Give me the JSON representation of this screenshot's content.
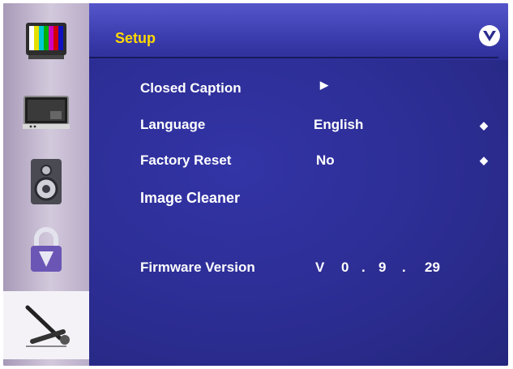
{
  "sidebar": {
    "items": [
      {
        "icon": "picture-tv-icon",
        "selected": false
      },
      {
        "icon": "monitor-icon",
        "selected": false
      },
      {
        "icon": "speaker-icon",
        "selected": false
      },
      {
        "icon": "lock-icon",
        "selected": false
      },
      {
        "icon": "wrench-screwdriver-icon",
        "selected": true
      }
    ]
  },
  "header": {
    "title": "Setup",
    "logo": "v-logo-icon",
    "title_color": "#ffd800"
  },
  "menu": {
    "closed_caption": {
      "label": "Closed Caption",
      "indicator": "▶"
    },
    "language": {
      "label": "Language",
      "value": "English",
      "adjust": "◆"
    },
    "factory_reset": {
      "label": "Factory Reset",
      "value": "No",
      "adjust": "◆"
    },
    "image_cleaner": {
      "label": "Image Cleaner"
    },
    "firmware": {
      "label": "Firmware Version",
      "parts": [
        "V",
        "0",
        ".",
        "9",
        ".",
        "29"
      ]
    }
  },
  "colors": {
    "background": "#2b2c8e",
    "header": "#3d3eb0",
    "sidebar": "#c5bad2",
    "selected_item": "#f4f2f7",
    "text": "#ffffff"
  }
}
